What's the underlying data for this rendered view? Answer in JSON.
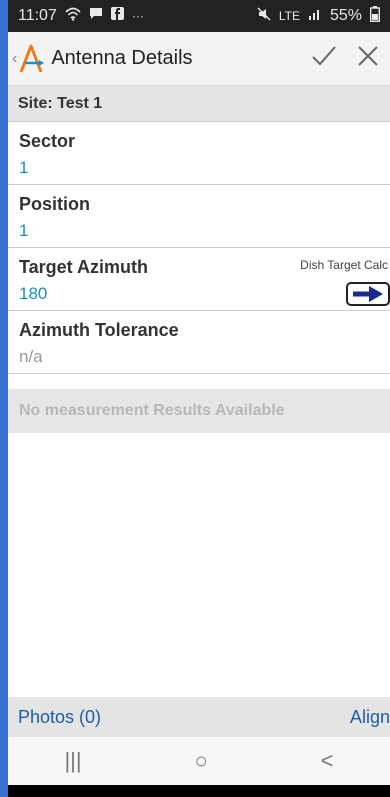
{
  "status": {
    "time": "11:07",
    "battery": "55%",
    "network": "LTE"
  },
  "header": {
    "title": "Antenna Details",
    "confirm_icon": "check-icon",
    "close_icon": "close-icon"
  },
  "site": {
    "label": "Site: Test 1"
  },
  "fields": {
    "sector": {
      "label": "Sector",
      "value": "1"
    },
    "position": {
      "label": "Position",
      "value": "1"
    },
    "azimuth": {
      "label": "Target Azimuth",
      "value": "180",
      "calc_label": "Dish Target Calc"
    },
    "tolerance": {
      "label": "Azimuth Tolerance",
      "value": "n/a"
    }
  },
  "measurements": {
    "empty_text": "No measurement Results Available"
  },
  "bottom": {
    "photos": "Photos (0)",
    "align": "Align"
  },
  "nav": {
    "recent": "|||",
    "home": "○",
    "back": "<"
  },
  "colors": {
    "accent": "#1b8fc0",
    "link": "#1c5fa8",
    "logo": "#f07a1a"
  }
}
